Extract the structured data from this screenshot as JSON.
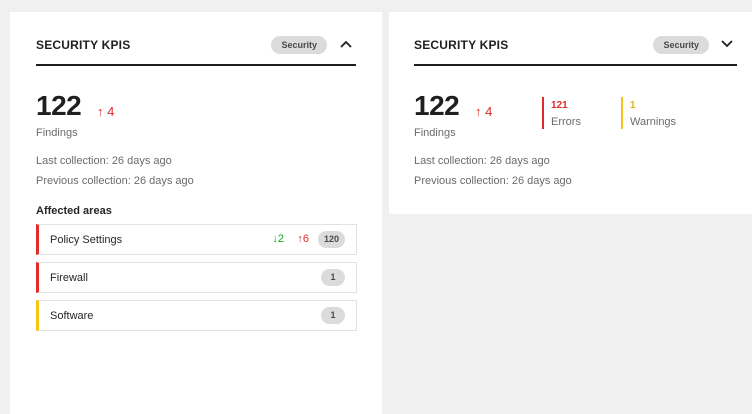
{
  "cards": [
    {
      "title": "SECURITY KPIS",
      "badge": "Security",
      "chevron": "chevron-up-icon",
      "findings_value": "122",
      "findings_trend": "↑ 4",
      "findings_label": "Findings",
      "last_collection": "Last collection: 26 days ago",
      "previous_collection": "Previous collection: 26 days ago",
      "affected_areas_title": "Affected areas",
      "areas": [
        {
          "name": "Policy Settings",
          "severity_color": "#e12a2a",
          "delta_down": "↓2",
          "delta_up": "↑6",
          "count": "120"
        },
        {
          "name": "Firewall",
          "severity_color": "#e12a2a",
          "count": "1"
        },
        {
          "name": "Software",
          "severity_color": "#f5c518",
          "count": "1"
        }
      ]
    },
    {
      "title": "SECURITY KPIS",
      "badge": "Security",
      "chevron": "chevron-down-icon",
      "findings_value": "122",
      "findings_trend": "↑ 4",
      "findings_label": "Findings",
      "errors_value": "121",
      "errors_label": "Errors",
      "warnings_value": "1",
      "warnings_label": "Warnings",
      "last_collection": "Last collection: 26 days ago",
      "previous_collection": "Previous collection: 26 days ago"
    }
  ],
  "colors": {
    "error": "#e12a2a",
    "warning": "#f5c518",
    "positive": "#0ca919"
  }
}
